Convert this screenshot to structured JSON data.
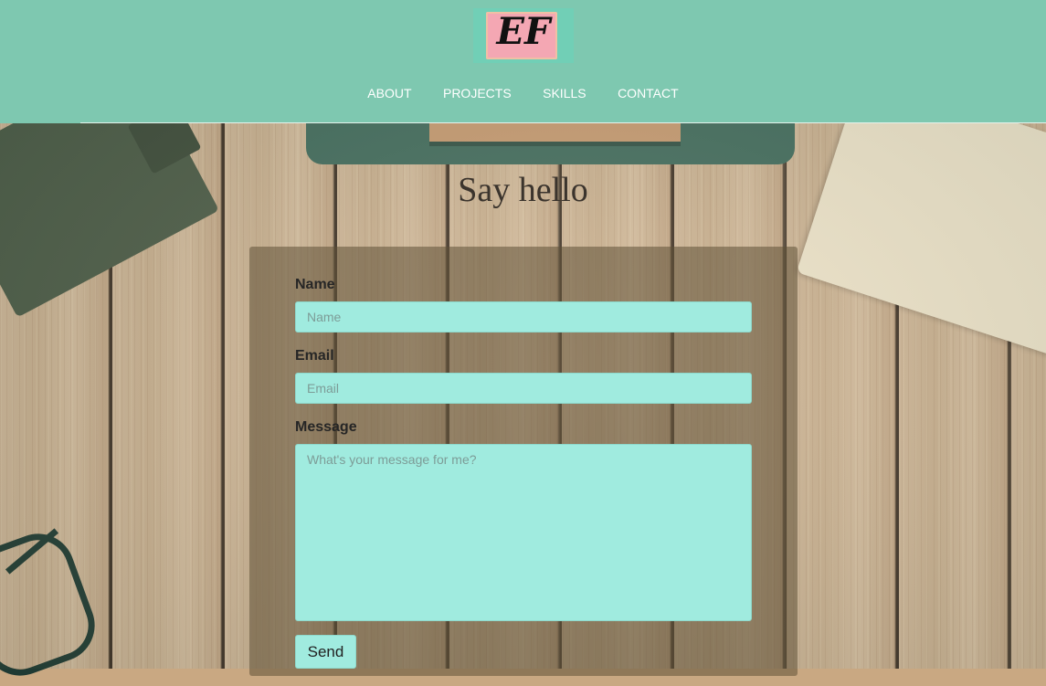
{
  "logo": {
    "text": "EF"
  },
  "nav": {
    "items": [
      "ABOUT",
      "PROJECTS",
      "SKILLS",
      "CONTACT"
    ]
  },
  "page": {
    "title": "Say hello"
  },
  "form": {
    "name_label": "Name",
    "name_placeholder": "Name",
    "email_label": "Email",
    "email_placeholder": "Email",
    "message_label": "Message",
    "message_placeholder": "What's your message for me?",
    "send_label": "Send"
  },
  "colors": {
    "header": "#7ec8b0",
    "field": "#a0ebdf",
    "logo_paper": "#f4a7b3"
  }
}
